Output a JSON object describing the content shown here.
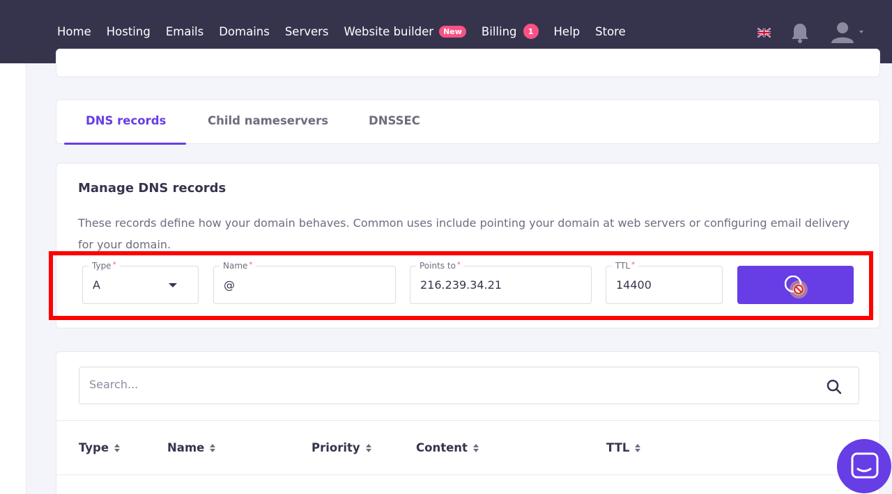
{
  "nav": {
    "items": [
      {
        "label": "Home"
      },
      {
        "label": "Hosting"
      },
      {
        "label": "Emails"
      },
      {
        "label": "Domains"
      },
      {
        "label": "Servers"
      },
      {
        "label": "Website builder",
        "badge": "New"
      },
      {
        "label": "Billing",
        "count": "1"
      },
      {
        "label": "Help"
      },
      {
        "label": "Store"
      }
    ],
    "language_icon": "uk-flag-icon",
    "notifications_icon": "bell-icon",
    "account_icon": "user-avatar-icon"
  },
  "tabs": [
    {
      "label": "DNS records",
      "active": true
    },
    {
      "label": "Child nameservers",
      "active": false
    },
    {
      "label": "DNSSEC",
      "active": false
    }
  ],
  "manage": {
    "title": "Manage DNS records",
    "description": "These records define how your domain behaves. Common uses include pointing your domain at web servers or configuring email delivery for your domain."
  },
  "form": {
    "type": {
      "label": "Type",
      "required_mark": "*",
      "value": "A"
    },
    "name": {
      "label": "Name",
      "required_mark": "*",
      "value": "@"
    },
    "points_to": {
      "label": "Points to",
      "required_mark": "*",
      "value": "216.239.34.21"
    },
    "ttl": {
      "label": "TTL",
      "required_mark": "*",
      "value": "14400"
    },
    "submit_button": {
      "icon": "not-allowed-cursor-icon"
    }
  },
  "records": {
    "search_placeholder": "Search...",
    "columns": [
      "Type",
      "Name",
      "Priority",
      "Content",
      "TTL"
    ]
  },
  "colors": {
    "nav_bg": "#36344d",
    "accent": "#673de6",
    "badge": "#fc5185",
    "highlight_box": "#ff0000"
  }
}
